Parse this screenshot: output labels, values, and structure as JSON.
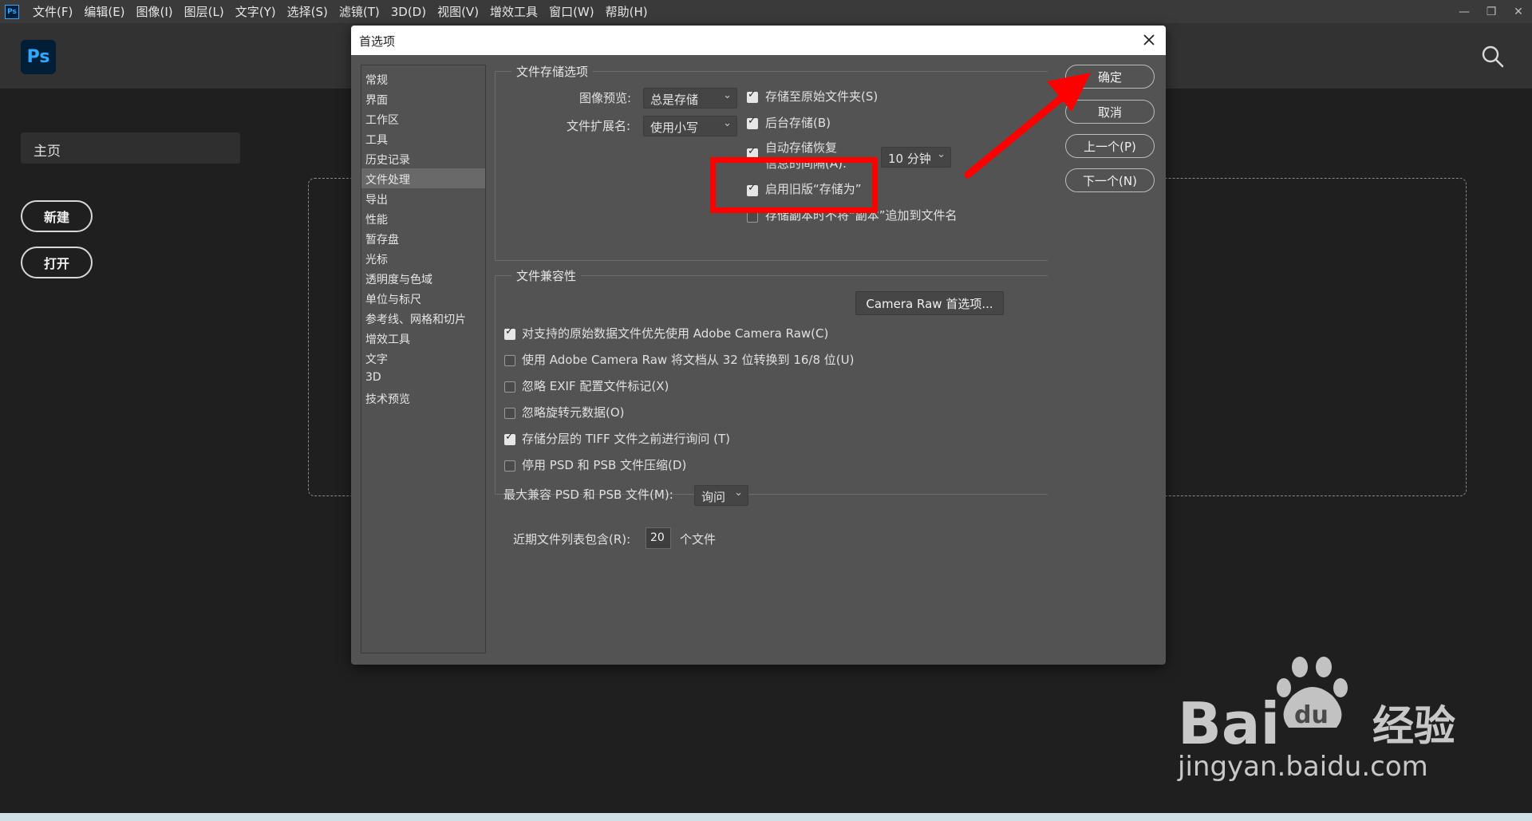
{
  "menubar": {
    "app_icon": "Ps",
    "items": [
      "文件(F)",
      "编辑(E)",
      "图像(I)",
      "图层(L)",
      "文字(Y)",
      "选择(S)",
      "滤镜(T)",
      "3D(D)",
      "视图(V)",
      "增效工具",
      "窗口(W)",
      "帮助(H)"
    ],
    "controls": [
      "minimize-icon",
      "restore-icon",
      "close-icon"
    ]
  },
  "topbar": {
    "logo": "Ps",
    "search_icon": "search-icon"
  },
  "sidebar": {
    "home": "主页",
    "new_button": "新建",
    "open_button": "打开"
  },
  "dialog": {
    "title": "首选项",
    "categories": [
      "常规",
      "界面",
      "工作区",
      "工具",
      "历史记录",
      "文件处理",
      "导出",
      "性能",
      "暂存盘",
      "光标",
      "透明度与色域",
      "单位与标尺",
      "参考线、网格和切片",
      "增效工具",
      "文字",
      "3D",
      "技术预览"
    ],
    "active_category": "文件处理",
    "buttons": {
      "ok": "确定",
      "cancel": "取消",
      "prev": "上一个(P)",
      "next": "下一个(N)"
    },
    "file_save": {
      "title": "文件存储选项",
      "image_preview_label": "图像预览:",
      "image_preview_value": "总是存储",
      "file_ext_label": "文件扩展名:",
      "file_ext_value": "使用小写",
      "save_to_original": {
        "label": "存储至原始文件夹(S)",
        "checked": true
      },
      "background_save": {
        "label": "后台存储(B)",
        "checked": true
      },
      "auto_recovery": {
        "label": "自动存储恢复",
        "label2": "信息的间隔(A):",
        "checked": true
      },
      "auto_recovery_interval": "10 分钟",
      "legacy_save_as": {
        "label": "启用旧版“存储为”",
        "checked": true
      },
      "copy_suffix": {
        "label": "存储副本时不将“副本”追加到文件名",
        "checked": false
      }
    },
    "compat": {
      "title": "文件兼容性",
      "camera_raw_button": "Camera Raw 首选项...",
      "options": [
        {
          "label": "对支持的原始数据文件优先使用 Adobe Camera Raw(C)",
          "checked": true
        },
        {
          "label": "使用 Adobe Camera Raw 将文档从 32 位转换到 16/8 位(U)",
          "checked": false
        },
        {
          "label": "忽略 EXIF 配置文件标记(X)",
          "checked": false
        },
        {
          "label": "忽略旋转元数据(O)",
          "checked": false
        },
        {
          "label": "存储分层的 TIFF 文件之前进行询问 (T)",
          "checked": true
        },
        {
          "label": "停用 PSD 和 PSB 文件压缩(D)",
          "checked": false
        }
      ],
      "max_compat_label": "最大兼容 PSD 和 PSB 文件(M):",
      "max_compat_value": "询问"
    },
    "recent": {
      "label": "近期文件列表包含(R):",
      "value": "20",
      "suffix": "个文件"
    }
  },
  "watermark": {
    "brand": "Bai",
    "brand2": "du",
    "cn": "经验",
    "url": "jingyan.baidu.com"
  },
  "colors": {
    "annotation": "#ff0000",
    "ps_blue": "#31a8ff",
    "ps_dark": "#001e36"
  }
}
